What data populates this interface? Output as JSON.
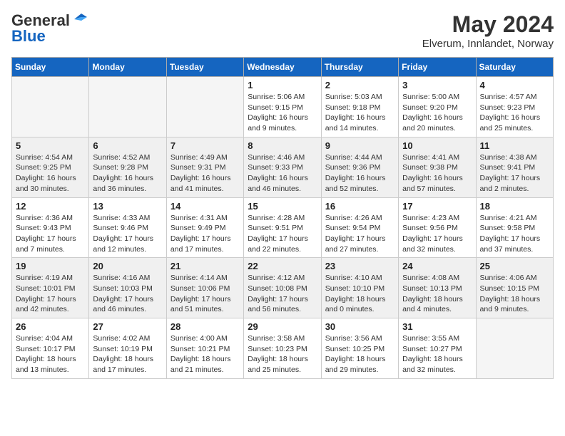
{
  "logo": {
    "line1": "General",
    "line2": "Blue"
  },
  "title": "May 2024",
  "subtitle": "Elverum, Innlandet, Norway",
  "days_of_week": [
    "Sunday",
    "Monday",
    "Tuesday",
    "Wednesday",
    "Thursday",
    "Friday",
    "Saturday"
  ],
  "weeks": [
    [
      {
        "num": "",
        "info": ""
      },
      {
        "num": "",
        "info": ""
      },
      {
        "num": "",
        "info": ""
      },
      {
        "num": "1",
        "info": "Sunrise: 5:06 AM\nSunset: 9:15 PM\nDaylight: 16 hours\nand 9 minutes."
      },
      {
        "num": "2",
        "info": "Sunrise: 5:03 AM\nSunset: 9:18 PM\nDaylight: 16 hours\nand 14 minutes."
      },
      {
        "num": "3",
        "info": "Sunrise: 5:00 AM\nSunset: 9:20 PM\nDaylight: 16 hours\nand 20 minutes."
      },
      {
        "num": "4",
        "info": "Sunrise: 4:57 AM\nSunset: 9:23 PM\nDaylight: 16 hours\nand 25 minutes."
      }
    ],
    [
      {
        "num": "5",
        "info": "Sunrise: 4:54 AM\nSunset: 9:25 PM\nDaylight: 16 hours\nand 30 minutes."
      },
      {
        "num": "6",
        "info": "Sunrise: 4:52 AM\nSunset: 9:28 PM\nDaylight: 16 hours\nand 36 minutes."
      },
      {
        "num": "7",
        "info": "Sunrise: 4:49 AM\nSunset: 9:31 PM\nDaylight: 16 hours\nand 41 minutes."
      },
      {
        "num": "8",
        "info": "Sunrise: 4:46 AM\nSunset: 9:33 PM\nDaylight: 16 hours\nand 46 minutes."
      },
      {
        "num": "9",
        "info": "Sunrise: 4:44 AM\nSunset: 9:36 PM\nDaylight: 16 hours\nand 52 minutes."
      },
      {
        "num": "10",
        "info": "Sunrise: 4:41 AM\nSunset: 9:38 PM\nDaylight: 16 hours\nand 57 minutes."
      },
      {
        "num": "11",
        "info": "Sunrise: 4:38 AM\nSunset: 9:41 PM\nDaylight: 17 hours\nand 2 minutes."
      }
    ],
    [
      {
        "num": "12",
        "info": "Sunrise: 4:36 AM\nSunset: 9:43 PM\nDaylight: 17 hours\nand 7 minutes."
      },
      {
        "num": "13",
        "info": "Sunrise: 4:33 AM\nSunset: 9:46 PM\nDaylight: 17 hours\nand 12 minutes."
      },
      {
        "num": "14",
        "info": "Sunrise: 4:31 AM\nSunset: 9:49 PM\nDaylight: 17 hours\nand 17 minutes."
      },
      {
        "num": "15",
        "info": "Sunrise: 4:28 AM\nSunset: 9:51 PM\nDaylight: 17 hours\nand 22 minutes."
      },
      {
        "num": "16",
        "info": "Sunrise: 4:26 AM\nSunset: 9:54 PM\nDaylight: 17 hours\nand 27 minutes."
      },
      {
        "num": "17",
        "info": "Sunrise: 4:23 AM\nSunset: 9:56 PM\nDaylight: 17 hours\nand 32 minutes."
      },
      {
        "num": "18",
        "info": "Sunrise: 4:21 AM\nSunset: 9:58 PM\nDaylight: 17 hours\nand 37 minutes."
      }
    ],
    [
      {
        "num": "19",
        "info": "Sunrise: 4:19 AM\nSunset: 10:01 PM\nDaylight: 17 hours\nand 42 minutes."
      },
      {
        "num": "20",
        "info": "Sunrise: 4:16 AM\nSunset: 10:03 PM\nDaylight: 17 hours\nand 46 minutes."
      },
      {
        "num": "21",
        "info": "Sunrise: 4:14 AM\nSunset: 10:06 PM\nDaylight: 17 hours\nand 51 minutes."
      },
      {
        "num": "22",
        "info": "Sunrise: 4:12 AM\nSunset: 10:08 PM\nDaylight: 17 hours\nand 56 minutes."
      },
      {
        "num": "23",
        "info": "Sunrise: 4:10 AM\nSunset: 10:10 PM\nDaylight: 18 hours\nand 0 minutes."
      },
      {
        "num": "24",
        "info": "Sunrise: 4:08 AM\nSunset: 10:13 PM\nDaylight: 18 hours\nand 4 minutes."
      },
      {
        "num": "25",
        "info": "Sunrise: 4:06 AM\nSunset: 10:15 PM\nDaylight: 18 hours\nand 9 minutes."
      }
    ],
    [
      {
        "num": "26",
        "info": "Sunrise: 4:04 AM\nSunset: 10:17 PM\nDaylight: 18 hours\nand 13 minutes."
      },
      {
        "num": "27",
        "info": "Sunrise: 4:02 AM\nSunset: 10:19 PM\nDaylight: 18 hours\nand 17 minutes."
      },
      {
        "num": "28",
        "info": "Sunrise: 4:00 AM\nSunset: 10:21 PM\nDaylight: 18 hours\nand 21 minutes."
      },
      {
        "num": "29",
        "info": "Sunrise: 3:58 AM\nSunset: 10:23 PM\nDaylight: 18 hours\nand 25 minutes."
      },
      {
        "num": "30",
        "info": "Sunrise: 3:56 AM\nSunset: 10:25 PM\nDaylight: 18 hours\nand 29 minutes."
      },
      {
        "num": "31",
        "info": "Sunrise: 3:55 AM\nSunset: 10:27 PM\nDaylight: 18 hours\nand 32 minutes."
      },
      {
        "num": "",
        "info": ""
      }
    ]
  ]
}
